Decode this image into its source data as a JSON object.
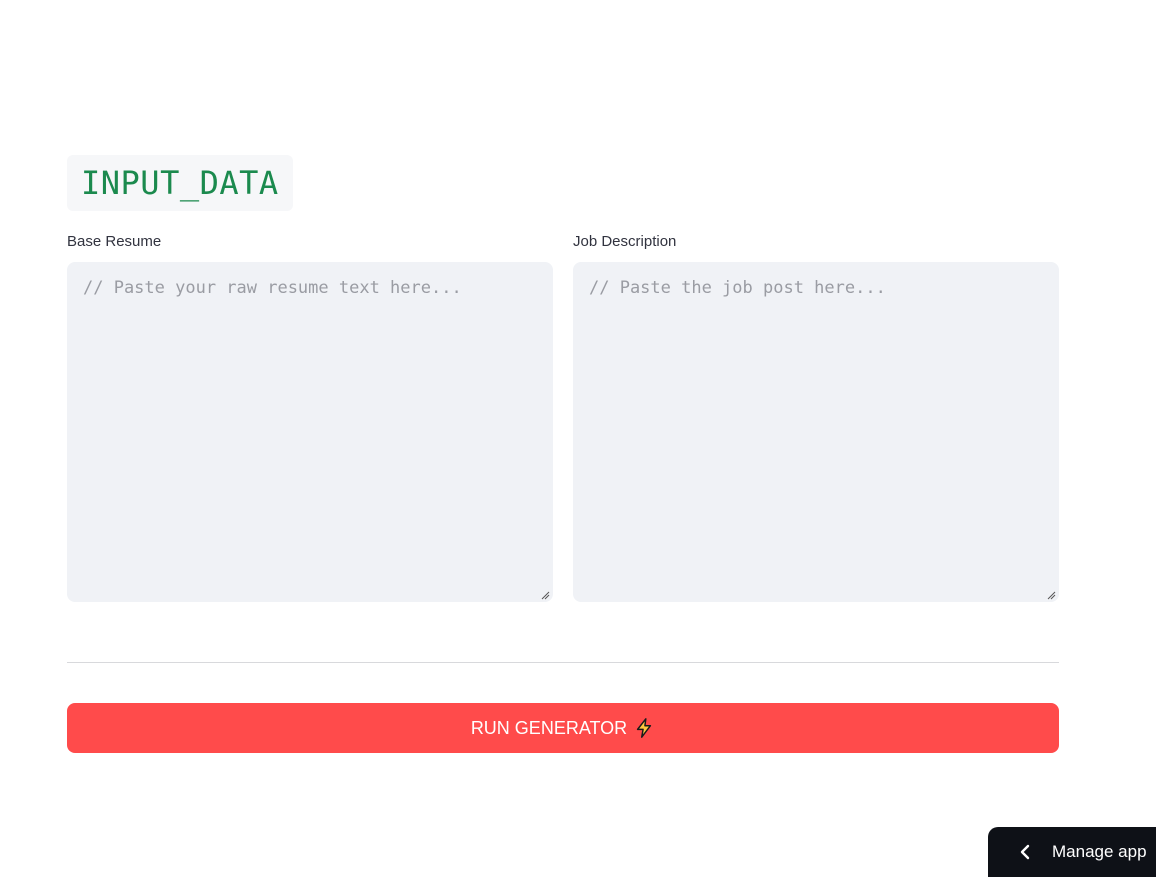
{
  "heading": {
    "text": "INPUT_DATA"
  },
  "fields": {
    "resume": {
      "label": "Base Resume",
      "placeholder": "// Paste your raw resume text here...",
      "value": ""
    },
    "job": {
      "label": "Job Description",
      "placeholder": "// Paste the job post here...",
      "value": ""
    }
  },
  "actions": {
    "run_label": "RUN GENERATOR",
    "run_icon": "lightning-bolt-icon"
  },
  "manage_app": {
    "label": "Manage app",
    "icon": "chevron-left-icon"
  },
  "colors": {
    "accent": "#ff4b4b",
    "heading_text": "#1b8a4e",
    "input_bg": "#f0f2f6",
    "manage_bg": "#0e1117"
  }
}
